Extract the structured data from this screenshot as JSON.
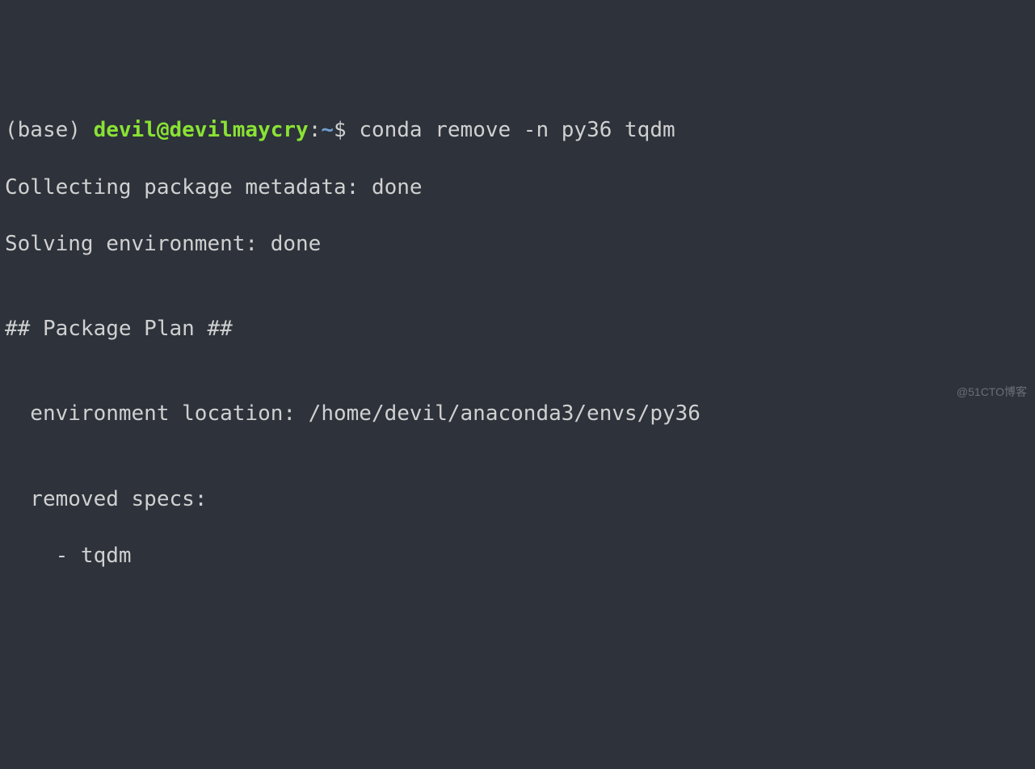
{
  "prompt": {
    "env": "(base) ",
    "userhost": "devil@devilmaycry",
    "colon": ":",
    "path": "~",
    "dollar": "$ ",
    "command": "conda remove -n py36 tqdm"
  },
  "output": {
    "line1": "Collecting package metadata: done",
    "line2": "Solving environment: done",
    "blank1": "",
    "plan_header": "## Package Plan ##",
    "blank2": "",
    "env_location": "  environment location: /home/devil/anaconda3/envs/py36",
    "blank3": "",
    "removed_specs_label": "  removed specs:",
    "removed_spec_item": "    - tqdm"
  },
  "watermark": "@51CTO博客"
}
